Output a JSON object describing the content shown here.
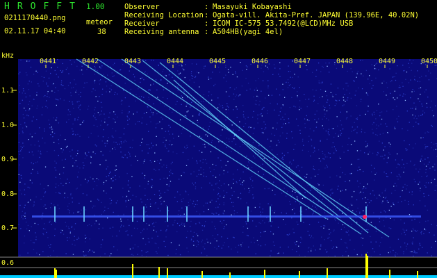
{
  "header": {
    "app_name": "HROFFT",
    "version": "1.00",
    "filename": "0211170440.png",
    "datetime": "02.11.17 04:40",
    "meteor_label": "meteor",
    "meteor_count": "38"
  },
  "info": [
    {
      "key": "Observer",
      "value": "Masayuki Kobayashi"
    },
    {
      "key": "Receiving Location",
      "value": "Ogata-vill. Akita-Pref. JAPAN (139.96E, 40.02N)"
    },
    {
      "key": "Receiver",
      "value": "ICOM IC-575 53.7492(@LCD)MHz USB"
    },
    {
      "key": "Receiving antenna",
      "value": "A504HB(yagi 4el)"
    }
  ],
  "waterfall": {
    "unit": "kHz",
    "freq_labels": [
      "1.1",
      "1.0",
      "0.9",
      "0.8",
      "0.7",
      "0.6"
    ],
    "time_labels": [
      "0441",
      "0442",
      "0443",
      "0444",
      "0445",
      "0446",
      "0447",
      "0448",
      "0449",
      "0450"
    ],
    "colors": {
      "background": "#0a0a78",
      "text": "#ffff33",
      "trace": "#66ddff",
      "histogram": "#ffff00",
      "title": "#2ee82e"
    }
  }
}
